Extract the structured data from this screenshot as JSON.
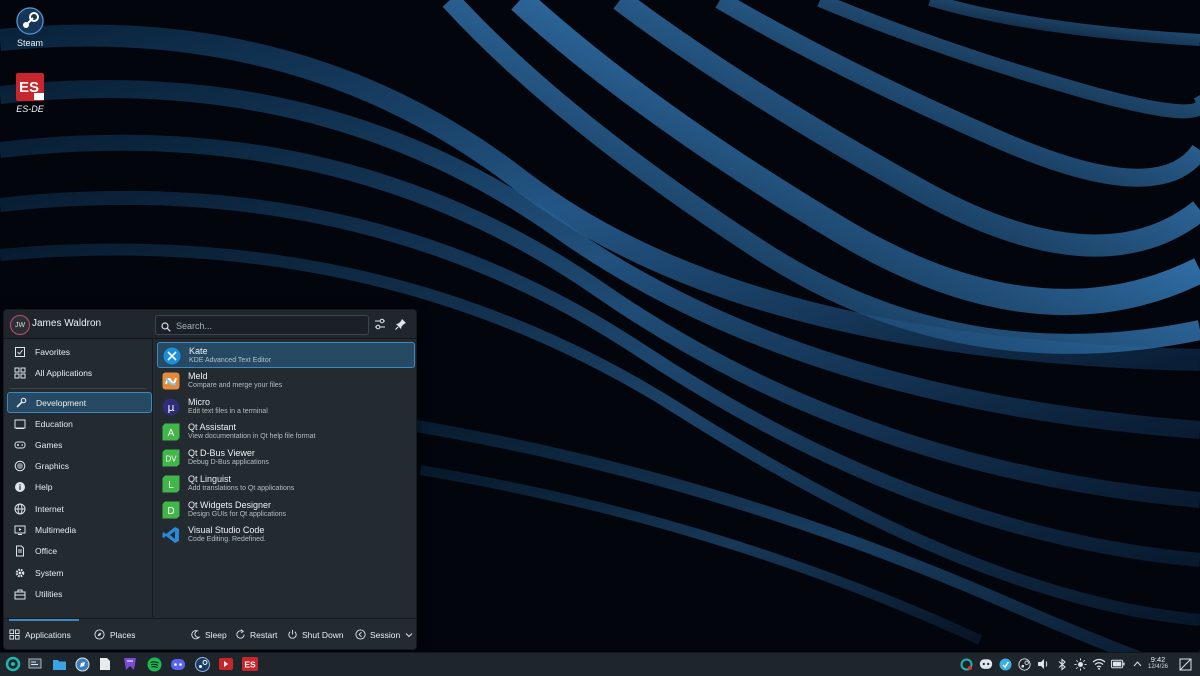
{
  "desktop": {
    "icons": [
      {
        "label": "Steam"
      },
      {
        "label": "ES-DE"
      }
    ]
  },
  "launcher": {
    "user": {
      "initials": "JW",
      "name": "James Waldron"
    },
    "search": {
      "placeholder": "Search..."
    },
    "categories": [
      {
        "label": "Favorites",
        "icon": "star-icon"
      },
      {
        "label": "All Applications",
        "icon": "grid-icon"
      },
      {
        "label": "Development",
        "icon": "wrench-icon",
        "active": true
      },
      {
        "label": "Education",
        "icon": "education-icon"
      },
      {
        "label": "Games",
        "icon": "gamepad-icon"
      },
      {
        "label": "Graphics",
        "icon": "palette-icon"
      },
      {
        "label": "Help",
        "icon": "help-icon"
      },
      {
        "label": "Internet",
        "icon": "globe-icon"
      },
      {
        "label": "Multimedia",
        "icon": "multimedia-icon"
      },
      {
        "label": "Office",
        "icon": "document-icon"
      },
      {
        "label": "System",
        "icon": "gear-icon"
      },
      {
        "label": "Utilities",
        "icon": "toolbox-icon"
      }
    ],
    "apps": [
      {
        "name": "Kate",
        "description": "KDE Advanced Text Editor",
        "icon": "kate-icon",
        "highlighted": true
      },
      {
        "name": "Meld",
        "description": "Compare and merge your files",
        "icon": "meld-icon"
      },
      {
        "name": "Micro",
        "description": "Edit text files in a terminal",
        "icon": "micro-icon",
        "glyph": "μ"
      },
      {
        "name": "Qt Assistant",
        "description": "View documentation in Qt help file format",
        "icon": "qt-assistant-icon",
        "glyph": "A"
      },
      {
        "name": "Qt D-Bus Viewer",
        "description": "Debug D-Bus applications",
        "icon": "qt-dbus-viewer-icon",
        "glyph": "DV"
      },
      {
        "name": "Qt Linguist",
        "description": "Add translations to Qt applications",
        "icon": "qt-linguist-icon",
        "glyph": "L"
      },
      {
        "name": "Qt Widgets Designer",
        "description": "Design GUIs for Qt applications",
        "icon": "qt-designer-icon",
        "glyph": "D"
      },
      {
        "name": "Visual Studio Code",
        "description": "Code Editing. Redefined.",
        "icon": "vscode-icon"
      }
    ],
    "footer": {
      "applications_tab": "Applications",
      "places_tab": "Places",
      "sleep": "Sleep",
      "restart": "Restart",
      "shut_down": "Shut Down",
      "session": "Session"
    }
  },
  "taskbar": {
    "clock": {
      "time": "9:42",
      "date": "12/4/26"
    }
  },
  "colors": {
    "accent": "#3f88be",
    "selection": "#264a63",
    "panel": "#232a30",
    "taskbar": "#1e252b"
  }
}
